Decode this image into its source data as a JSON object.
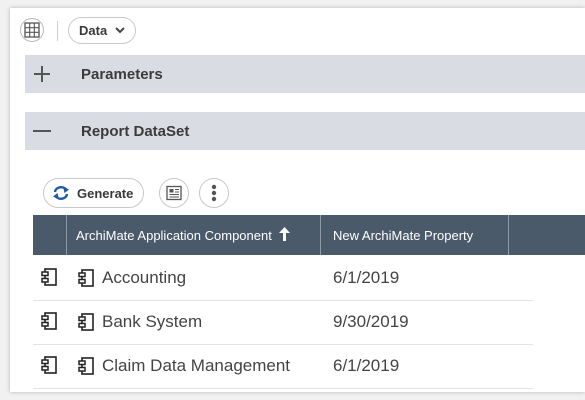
{
  "toolbar": {
    "grid_icon": "grid-icon",
    "data_label": "Data"
  },
  "sections": [
    {
      "sign": "+",
      "title": "Parameters"
    },
    {
      "sign": "—",
      "title": "Report DataSet"
    }
  ],
  "actions": {
    "generate_label": "Generate"
  },
  "table": {
    "columns": [
      "ArchiMate Application Component",
      "New ArchiMate Property"
    ],
    "sort_indicator": "↑",
    "rows": [
      {
        "name": "Accounting",
        "date": "6/1/2019"
      },
      {
        "name": "Bank System",
        "date": "9/30/2019"
      },
      {
        "name": "Claim Data Management",
        "date": "6/1/2019"
      }
    ]
  },
  "colors": {
    "header_bg": "#4a5a6b",
    "section_bg": "#d9dce3",
    "accent_blue": "#1e5aa8"
  }
}
